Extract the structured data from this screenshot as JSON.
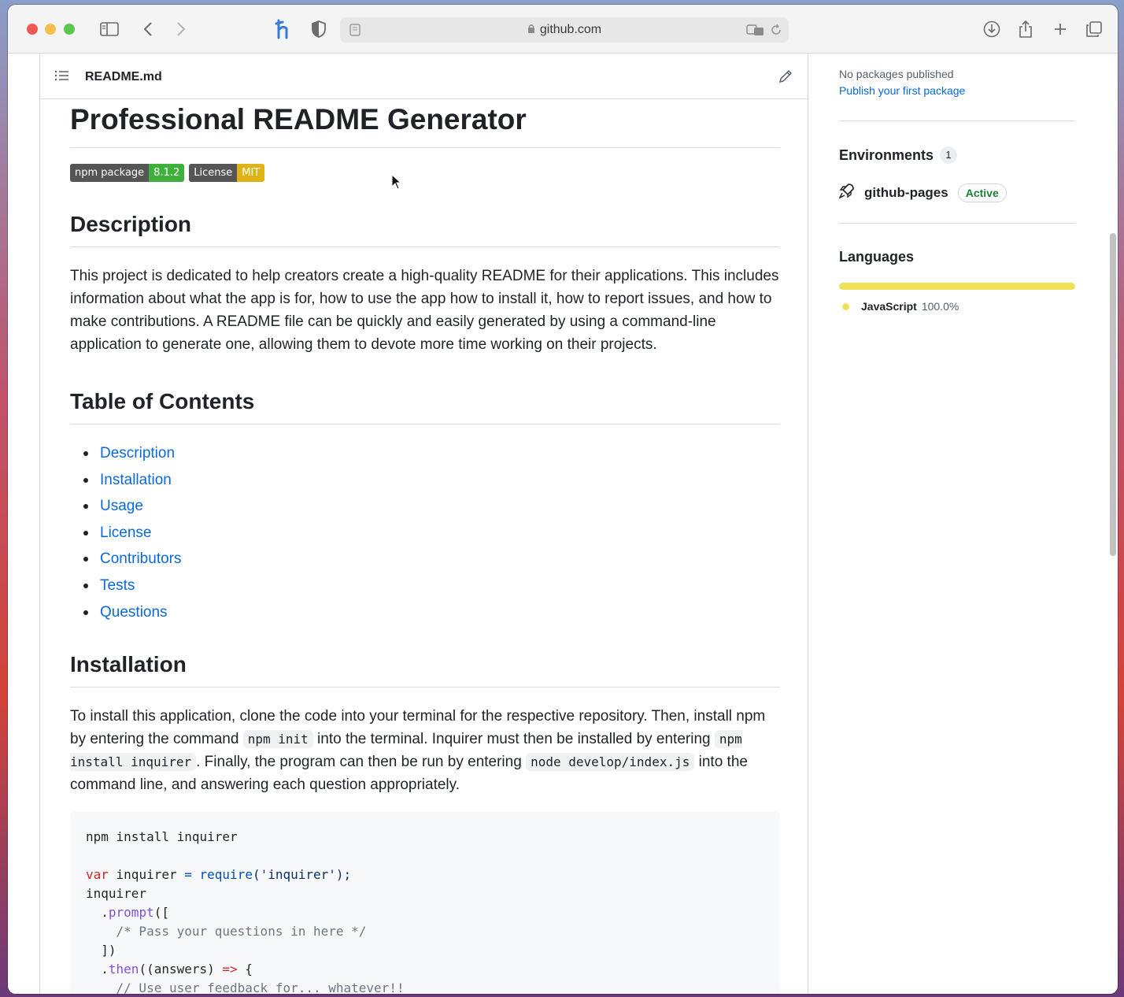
{
  "browser": {
    "url": "github.com"
  },
  "file_header": {
    "name": "README.md"
  },
  "readme": {
    "title": "Professional README Generator",
    "badges": [
      {
        "left": "npm package",
        "right": "8.1.2",
        "color": "#3fb03b"
      },
      {
        "left": "License",
        "right": "MIT",
        "color": "#dfb317"
      }
    ],
    "description_heading": "Description",
    "description": "This project is dedicated to help creators create a high-quality README for their applications. This includes information about what the app is for, how to use the app how to install it, how to report issues, and how to make contributions. A README file can be quickly and easily generated by using a command-line application to generate one, allowing them to devote more time working on their projects.",
    "toc_heading": "Table of Contents",
    "toc": [
      "Description",
      "Installation",
      "Usage",
      "License",
      "Contributors",
      "Tests",
      "Questions"
    ],
    "installation_heading": "Installation",
    "installation": {
      "t1": "To install this application, clone the code into your terminal for the respective repository. Then, install npm by entering the command ",
      "c1": "npm init",
      "t2": " into the terminal. Inquirer must then be installed by entering ",
      "c2": "npm install inquirer",
      "t3": ". Finally, the program can then be run by entering ",
      "c3": "node develop/index.js",
      "t4": " into the command line, and answering each question appropriately."
    },
    "code": {
      "line1": "npm install inquirer",
      "var_kw": "var",
      "var_name": " inquirer ",
      "eq": "=",
      "require_fn": "require",
      "require_arg": "('inquirer');",
      "line4": "inquirer",
      "prompt_dot": "  .",
      "prompt_fn": "prompt",
      "prompt_rest": "([",
      "comment1": "    /* Pass your questions in here */",
      "close": "  ])",
      "then_dot": "  .",
      "then_fn": "then",
      "then_rest": "((answers) ",
      "arrow": "=>",
      "then_end": " {",
      "comment2": "    // Use user feedback for... whatever!!"
    }
  },
  "sidebar": {
    "packages_text": "No packages published",
    "packages_link": "Publish your first package",
    "environments_heading": "Environments",
    "environments_count": "1",
    "environment_name": "github-pages",
    "environment_status": "Active",
    "languages_heading": "Languages",
    "language_name": "JavaScript",
    "language_percent": "100.0%",
    "language_color": "#f1e05a"
  }
}
